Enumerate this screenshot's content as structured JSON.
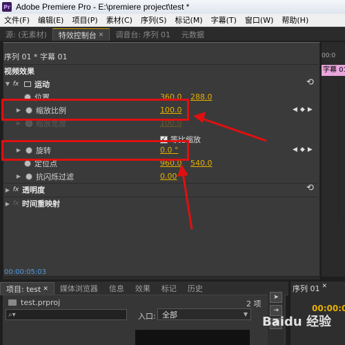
{
  "window": {
    "app_icon": "Pr",
    "title": "Adobe Premiere Pro - E:\\premiere project\\test *"
  },
  "menubar": [
    "文件(F)",
    "编辑(E)",
    "项目(P)",
    "素材(C)",
    "序列(S)",
    "标记(M)",
    "字幕(T)",
    "窗口(W)",
    "帮助(H)"
  ],
  "top_tabs": {
    "source": "源: (无素材)",
    "effect_controls": "特效控制台",
    "audio_mixer": "调音台: 序列 01",
    "metadata": "元数据"
  },
  "effect_panel": {
    "sequence_header": "序列 01 * 字幕 01",
    "video_effects_label": "视频效果",
    "motion": {
      "label": "运动",
      "position": {
        "label": "位置",
        "x": "360.0",
        "y": "288.0"
      },
      "scale": {
        "label": "缩放比例",
        "value": "100.0"
      },
      "scale_width": {
        "label": "缩放宽度",
        "value": "100.0"
      },
      "uniform_scale": {
        "label": "等比缩放",
        "checked": true
      },
      "rotation": {
        "label": "旋转",
        "value": "0.0 °"
      },
      "anchor": {
        "label": "定位点",
        "x": "960.0",
        "y": "540.0"
      },
      "anti_flicker": {
        "label": "抗闪烁过滤",
        "value": "0.00"
      }
    },
    "opacity_label": "透明度",
    "time_remap_label": "时间重映射",
    "timecode": "00:00:05:03",
    "right_ruler": "00:0",
    "sequence_clip_tag": "字幕 01"
  },
  "bottom_tabs": [
    "项目: test",
    "媒体浏览器",
    "信息",
    "效果",
    "标记",
    "历史"
  ],
  "project": {
    "file": "test.prproj",
    "item_count": "2 项",
    "search_placeholder": "",
    "in_label": "入口:",
    "in_value": "全部"
  },
  "sequence_panel": {
    "tab": "序列 01",
    "timecode": "00:00:0"
  },
  "colors": {
    "highlight": "#e01010",
    "value_accent": "#e8b000",
    "clip_tag": "#e8a6dc"
  },
  "watermark": "Baidu 经验"
}
